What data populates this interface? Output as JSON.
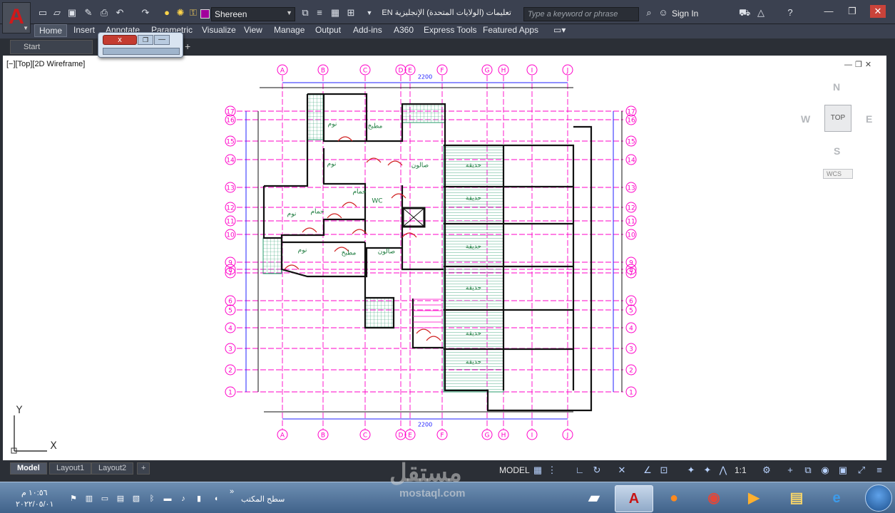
{
  "app": {
    "logo_letter": "A",
    "workspace_name": "Shereen",
    "document_title": "تعليمات  (الولايات المتحدة) الإنجليزية EN",
    "search_placeholder": "Type a keyword or phrase",
    "sign_in_label": "Sign In",
    "workspace_color": "#a1009b"
  },
  "ribbon": {
    "tabs": [
      "Home",
      "Insert",
      "Annotate",
      "Parametric",
      "Visualize",
      "View",
      "Manage",
      "Output",
      "Add-ins",
      "A360",
      "Express Tools",
      "Featured Apps"
    ],
    "active_tab": "Home"
  },
  "file_tabs": {
    "start_label": "Start",
    "add_label": "+"
  },
  "floating_window": {
    "close_label": "x"
  },
  "drawing": {
    "viewport_label": "[−][Top][2D Wireframe]",
    "axes": {
      "x_label": "X",
      "y_label": "Y"
    },
    "column_grid": [
      "A",
      "B",
      "C",
      "D",
      "E",
      "F",
      "G",
      "H",
      "I",
      "J"
    ],
    "row_grid": [
      "17",
      "16",
      "15",
      "14",
      "13",
      "12",
      "11",
      "10",
      "9",
      "8",
      "7",
      "6",
      "5",
      "4",
      "3",
      "2",
      "1"
    ],
    "overall_dimension": "2200",
    "room_labels": [
      "نوم",
      "مطبخ",
      "صالون",
      "نوم",
      "حمام",
      "نوم",
      "حمام",
      "WC",
      "نوم",
      "مطبخ",
      "صالون",
      "حديقة",
      "حديقة",
      "حديقة",
      "حديقة",
      "حديقة",
      "حديقة"
    ],
    "grid_line_color": "#ff00c8",
    "dimension_color": "#2020ff",
    "hatch_color": "#2a9d6e",
    "wall_color": "#111111"
  },
  "view_cube": {
    "north": "N",
    "south": "S",
    "east": "E",
    "west": "W",
    "face": "TOP",
    "wcs_label": "WCS"
  },
  "layout_tabs": [
    "Model",
    "Layout1",
    "Layout2"
  ],
  "layout_add": "+",
  "status_bar": {
    "model_label": "MODEL",
    "scale": "1:1"
  },
  "taskbar": {
    "time": "١٠:٥٦ م",
    "date": "٢٠٢٢/٠٥/٠١",
    "desktop_label": "سطح المكتب"
  },
  "watermark": {
    "brand": "مستقل",
    "domain": "mostaql.com"
  }
}
